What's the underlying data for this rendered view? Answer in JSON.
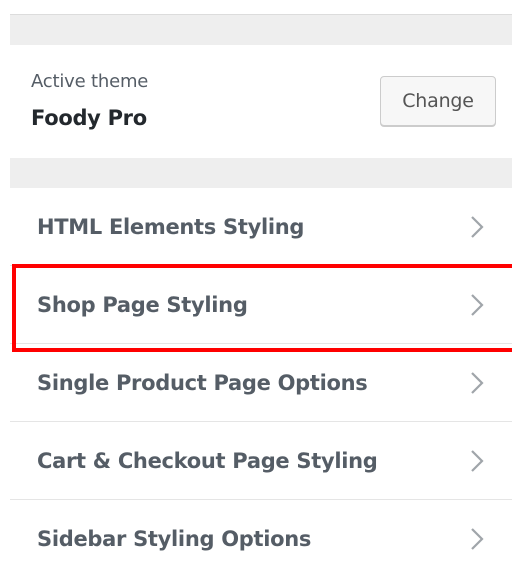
{
  "theme": {
    "label": "Active theme",
    "name": "Foody Pro",
    "change_label": "Change"
  },
  "menu": {
    "items": [
      {
        "label": "HTML Elements Styling",
        "icon": "chevron-right-icon"
      },
      {
        "label": "Shop Page Styling",
        "icon": "chevron-right-icon",
        "highlighted": true
      },
      {
        "label": "Single Product Page Options",
        "icon": "chevron-right-icon"
      },
      {
        "label": "Cart & Checkout Page Styling",
        "icon": "chevron-right-icon"
      },
      {
        "label": "Sidebar Styling Options",
        "icon": "chevron-right-icon"
      }
    ]
  },
  "colors": {
    "highlight_border": "#ff0000",
    "band_background": "#eeeeee",
    "label_text": "#555d66",
    "chevron": "#a0a5aa"
  }
}
